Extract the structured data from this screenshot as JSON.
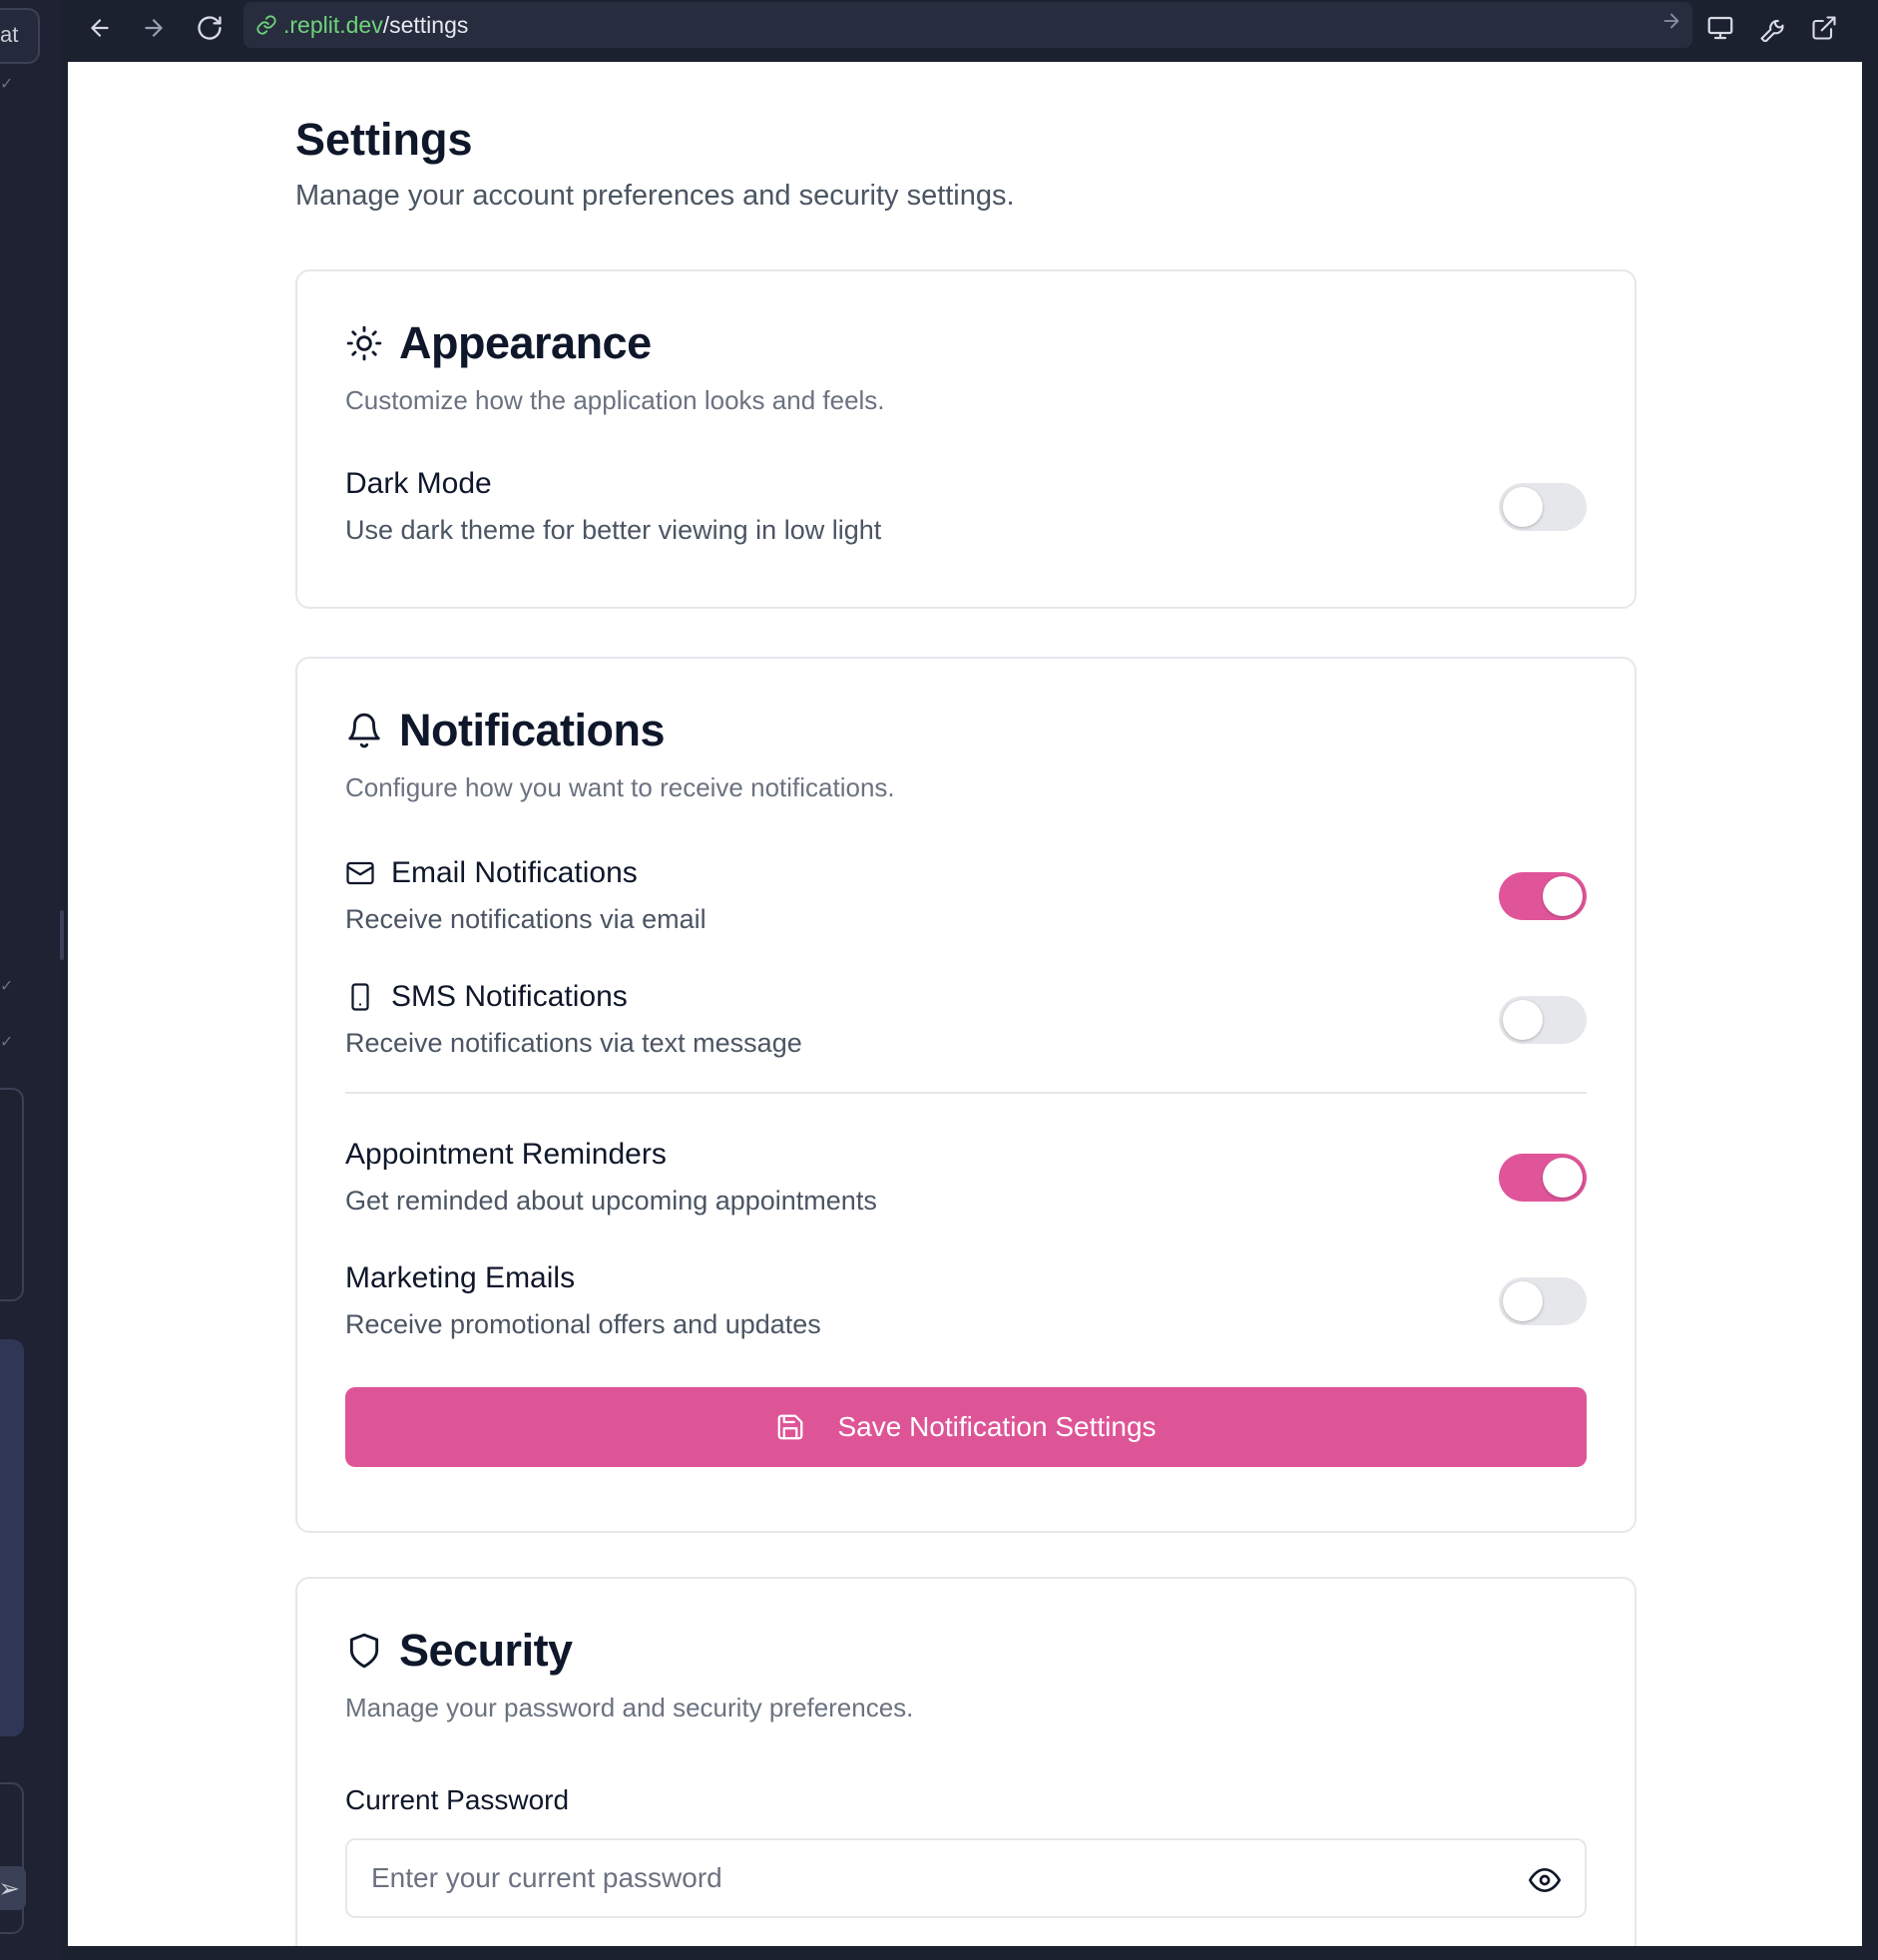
{
  "sidebar": {
    "chat_label": "at"
  },
  "browser": {
    "url_host": ".replit.dev",
    "url_path": "/settings"
  },
  "page": {
    "title": "Settings",
    "subtitle": "Manage your account preferences and security settings."
  },
  "appearance": {
    "icon": "sun-icon",
    "title": "Appearance",
    "description": "Customize how the application looks and feels.",
    "dark_mode": {
      "label": "Dark Mode",
      "description": "Use dark theme for better viewing in low light",
      "enabled": false
    }
  },
  "notifications": {
    "icon": "bell-icon",
    "title": "Notifications",
    "description": "Configure how you want to receive notifications.",
    "email": {
      "icon": "mail-icon",
      "label": "Email Notifications",
      "description": "Receive notifications via email",
      "enabled": true
    },
    "sms": {
      "icon": "smartphone-icon",
      "label": "SMS Notifications",
      "description": "Receive notifications via text message",
      "enabled": false
    },
    "appointments": {
      "label": "Appointment Reminders",
      "description": "Get reminded about upcoming appointments",
      "enabled": true
    },
    "marketing": {
      "label": "Marketing Emails",
      "description": "Receive promotional offers and updates",
      "enabled": false
    },
    "save_label": "Save Notification Settings"
  },
  "security": {
    "icon": "shield-icon",
    "title": "Security",
    "description": "Manage your password and security preferences.",
    "current_password": {
      "label": "Current Password",
      "placeholder": "Enter your current password",
      "value": ""
    }
  },
  "colors": {
    "accent": "#de5597",
    "toolbar": "#1c2130",
    "url_host": "#6fd37a"
  }
}
